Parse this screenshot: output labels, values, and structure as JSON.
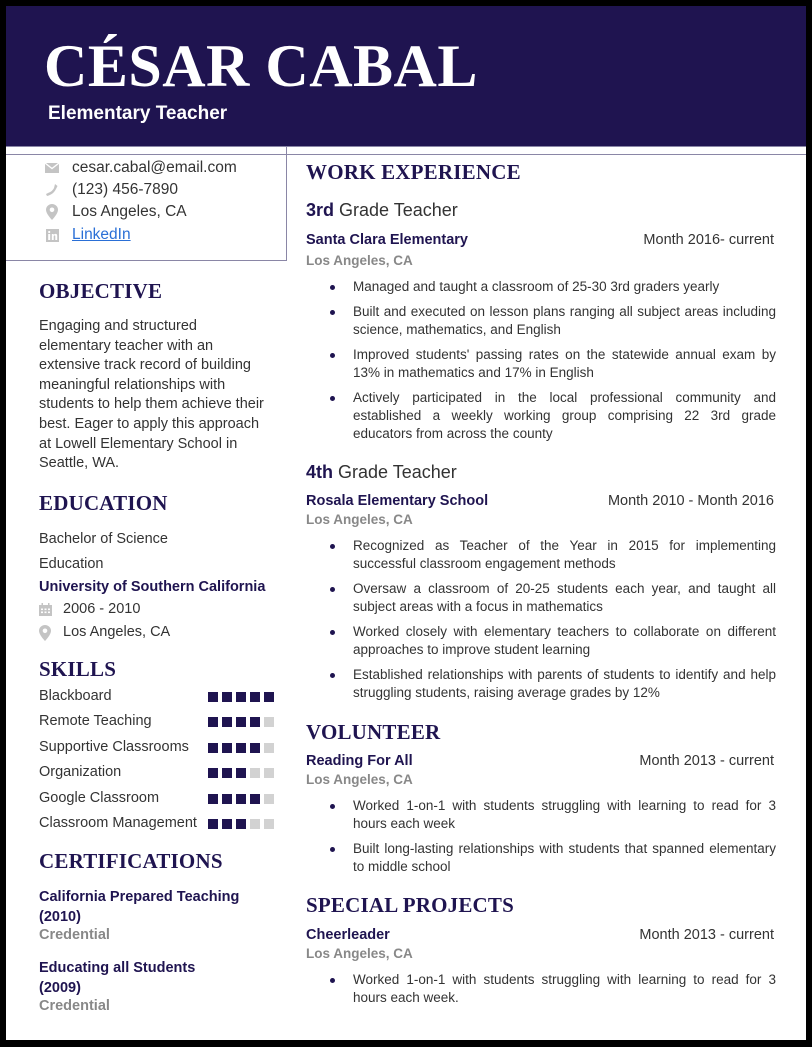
{
  "header": {
    "name": "CÉSAR CABAL",
    "title": "Elementary Teacher"
  },
  "contact": {
    "email": {
      "icon": "envelope-icon",
      "text": "cesar.cabal@email.com"
    },
    "phone": {
      "icon": "phone-icon",
      "text": "(123) 456-7890"
    },
    "location": {
      "icon": "map-pin-icon",
      "text": "Los Angeles, CA"
    },
    "linkedin": {
      "icon": "linkedin-icon",
      "text": "LinkedIn"
    }
  },
  "objective": {
    "heading": "OBJECTIVE",
    "lines": [
      "Engaging and structured",
      "elementary teacher with an",
      "extensive track record of building",
      "meaningful relationships with",
      "students to help them achieve their",
      "best. Eager to apply this approach",
      "at Lowell Elementary School in",
      "Seattle, WA."
    ]
  },
  "education": {
    "heading": "EDUCATION",
    "degree": "Bachelor of Science",
    "field": "Education",
    "school": "University of Southern California",
    "years": "2006 - 2010",
    "location": "Los Angeles, CA"
  },
  "skills": {
    "heading": "SKILLS",
    "max": 5,
    "items": [
      {
        "name": "Blackboard",
        "rating": 5
      },
      {
        "name": "Remote Teaching",
        "rating": 4
      },
      {
        "name": "Supportive Classrooms",
        "rating": 4
      },
      {
        "name": "Organization",
        "rating": 3
      },
      {
        "name": "Google Classroom",
        "rating": 4
      },
      {
        "name": "Classroom Management",
        "rating": 3
      }
    ]
  },
  "certifications": {
    "heading": "CERTIFICATIONS",
    "items": [
      {
        "line1": "California Prepared Teaching",
        "line2": "(2010)",
        "type": "Credential"
      },
      {
        "line1": "Educating all Students",
        "line2": "(2009)",
        "type": "Credential"
      }
    ]
  },
  "work": {
    "heading": "WORK EXPERIENCE",
    "jobs": [
      {
        "title_bold": "3rd",
        "title_rest": " Grade Teacher",
        "org": "Santa Clara Elementary",
        "dates": "Month 2016- current",
        "location": "Los Angeles, CA",
        "bullets": [
          "Managed and taught a classroom of 25-30 3rd graders yearly",
          "Built and executed on lesson plans ranging all subject areas including science, mathematics, and English",
          "Improved students' passing rates on the statewide annual exam by 13% in mathematics and 17% in English",
          "Actively participated in the local professional community and established a weekly working group comprising 22 3rd grade educators from across the county"
        ]
      },
      {
        "title_bold": "4th",
        "title_rest": " Grade Teacher",
        "org": "Rosala Elementary School",
        "dates": "Month 2010 - Month 2016",
        "location": "Los Angeles, CA",
        "bullets": [
          "Recognized as Teacher of the Year in 2015 for implementing successful classroom engagement methods",
          "Oversaw a classroom of 20-25 students each year, and taught all subject areas with a focus in mathematics",
          "Worked closely with elementary teachers to collaborate on different approaches to improve student learning",
          "Established relationships with parents of students to identify and help struggling students, raising average grades by 12%"
        ]
      }
    ]
  },
  "volunteer": {
    "heading": "VOLUNTEER",
    "org": "Reading For All",
    "dates": "Month 2013 - current",
    "location": "Los Angeles, CA",
    "bullets": [
      "Worked 1-on-1 with students struggling with learning to read for 3 hours each week",
      "Built long-lasting relationships with students that spanned elementary to middle school"
    ]
  },
  "projects": {
    "heading": "SPECIAL PROJECTS",
    "org": "Cheerleader",
    "dates": "Month 2013 - current",
    "location": "Los Angeles, CA",
    "bullets": [
      "Worked 1-on-1 with students struggling with learning to read for 3 hours each week."
    ]
  },
  "colors": {
    "navy": "#1f1450",
    "muted": "#888888",
    "link": "#2a6fd6",
    "skill_off": "#d2d2d2"
  }
}
